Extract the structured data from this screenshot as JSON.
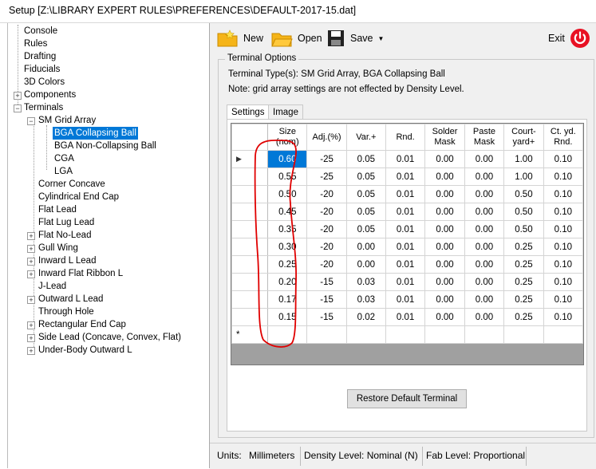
{
  "window": {
    "title": "Setup [Z:\\LIBRARY EXPERT RULES\\PREFERENCES\\DEFAULT-2017-15.dat]"
  },
  "tree": {
    "items": [
      {
        "label": "Console"
      },
      {
        "label": "Rules"
      },
      {
        "label": "Drafting"
      },
      {
        "label": "Fiducials"
      },
      {
        "label": "3D Colors"
      },
      {
        "label": "Components"
      },
      {
        "label": "Terminals"
      },
      {
        "label": "SM Grid Array"
      },
      {
        "label": "BGA Collapsing Ball"
      },
      {
        "label": "BGA Non-Collapsing Ball"
      },
      {
        "label": "CGA"
      },
      {
        "label": "LGA"
      },
      {
        "label": "Corner Concave"
      },
      {
        "label": "Cylindrical End Cap"
      },
      {
        "label": "Flat Lead"
      },
      {
        "label": "Flat Lug Lead"
      },
      {
        "label": "Flat No-Lead"
      },
      {
        "label": "Gull Wing"
      },
      {
        "label": "Inward L Lead"
      },
      {
        "label": "Inward Flat Ribbon L"
      },
      {
        "label": "J-Lead"
      },
      {
        "label": "Outward L Lead"
      },
      {
        "label": "Through Hole"
      },
      {
        "label": "Rectangular End Cap"
      },
      {
        "label": "Side Lead (Concave, Convex, Flat)"
      },
      {
        "label": "Under-Body Outward L"
      }
    ]
  },
  "toolbar": {
    "new_label": "New",
    "open_label": "Open",
    "save_label": "Save",
    "exit_label": "Exit"
  },
  "options": {
    "legend": "Terminal Options",
    "types_text": "Terminal Type(s): SM Grid Array, BGA Collapsing Ball",
    "note_text": "Note: grid array settings are not effected by Density Level."
  },
  "tabs": {
    "settings": "Settings",
    "image": "Image"
  },
  "table": {
    "headers": [
      "Size (nom)",
      "Adj.(%)",
      "Var.+",
      "Rnd.",
      "Solder Mask",
      "Paste Mask",
      "Court-yard+",
      "Ct. yd. Rnd."
    ],
    "rows": [
      [
        "0.60",
        "-25",
        "0.05",
        "0.01",
        "0.00",
        "0.00",
        "1.00",
        "0.10"
      ],
      [
        "0.55",
        "-25",
        "0.05",
        "0.01",
        "0.00",
        "0.00",
        "1.00",
        "0.10"
      ],
      [
        "0.50",
        "-20",
        "0.05",
        "0.01",
        "0.00",
        "0.00",
        "0.50",
        "0.10"
      ],
      [
        "0.45",
        "-20",
        "0.05",
        "0.01",
        "0.00",
        "0.00",
        "0.50",
        "0.10"
      ],
      [
        "0.35",
        "-20",
        "0.05",
        "0.01",
        "0.00",
        "0.00",
        "0.50",
        "0.10"
      ],
      [
        "0.30",
        "-20",
        "0.00",
        "0.01",
        "0.00",
        "0.00",
        "0.25",
        "0.10"
      ],
      [
        "0.25",
        "-20",
        "0.00",
        "0.01",
        "0.00",
        "0.00",
        "0.25",
        "0.10"
      ],
      [
        "0.20",
        "-15",
        "0.03",
        "0.01",
        "0.00",
        "0.00",
        "0.25",
        "0.10"
      ],
      [
        "0.17",
        "-15",
        "0.03",
        "0.01",
        "0.00",
        "0.00",
        "0.25",
        "0.10"
      ],
      [
        "0.15",
        "-15",
        "0.02",
        "0.01",
        "0.00",
        "0.00",
        "0.25",
        "0.10"
      ]
    ],
    "current_marker": "▶",
    "new_row_marker": "*"
  },
  "restore_label": "Restore Default Terminal",
  "status": {
    "units_label": "Units:",
    "units_value": "Millimeters",
    "density": "Density Level: Nominal (N)",
    "fab": "Fab Level: Proportional"
  },
  "colors": {
    "selection": "#0078d7",
    "exit_red": "#e81123",
    "folder": "#f5b418",
    "annotation": "#e00000"
  }
}
